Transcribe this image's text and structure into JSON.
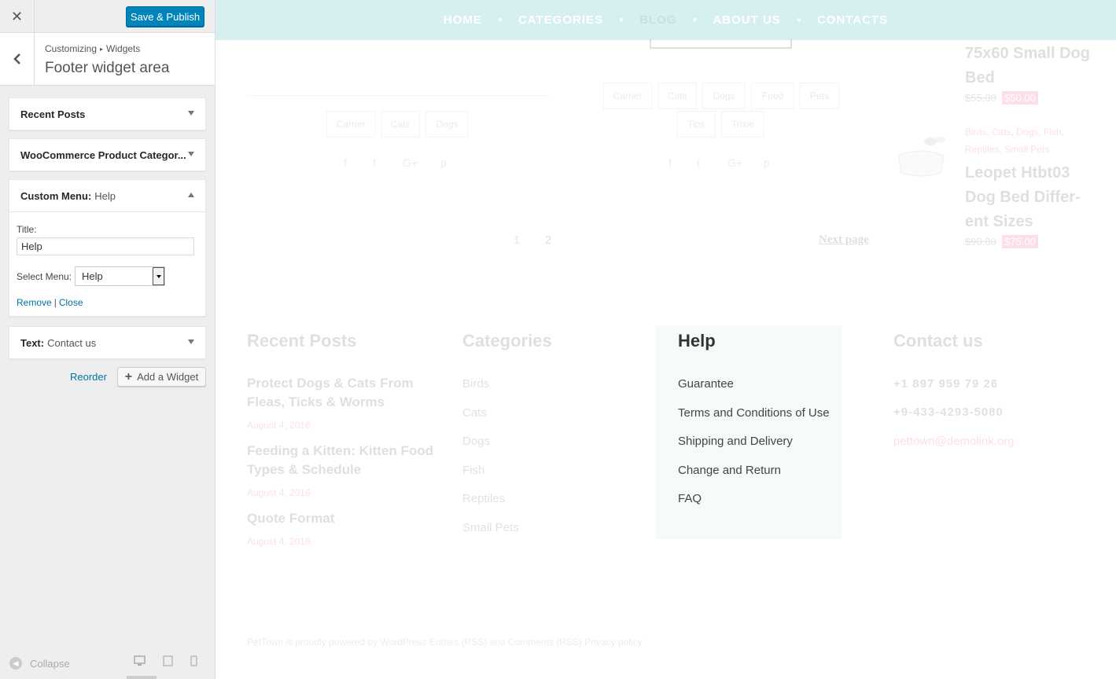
{
  "customizer": {
    "close_glyph": "✕",
    "publish_label": "Save & Publish",
    "breadcrumb": [
      "Customizing",
      "Widgets"
    ],
    "breadcrumb_sep": "▸",
    "section_title": "Footer widget area",
    "widgets": [
      {
        "title": "Recent Posts",
        "subtitle": ""
      },
      {
        "title": "WooCommerce Product Categor...",
        "subtitle": ""
      },
      {
        "title": "Custom Menu:",
        "subtitle": "Help"
      },
      {
        "title": "Text:",
        "subtitle": "Contact us"
      }
    ],
    "form": {
      "title_label": "Title:",
      "title_value": "Help",
      "select_label": "Select Menu:",
      "select_value": "Help",
      "remove_label": "Remove",
      "pipe": "|",
      "close_label": "Close"
    },
    "reorder_label": "Reorder",
    "add_widget_label": "Add a Widget",
    "collapse_label": "Collapse"
  },
  "preview": {
    "nav": [
      "HOME",
      "CATEGORIES",
      "BLOG",
      "ABOUT US",
      "CONTACTS"
    ],
    "left_tags": [
      "Carrier",
      "Cats",
      "Dogs"
    ],
    "mid_tags_row1": [
      "Carrier",
      "Cats",
      "Dogs",
      "Food",
      "Pets"
    ],
    "mid_tags_row2": [
      "Tips",
      "Trixie"
    ],
    "pagination": {
      "page1": "1",
      "page2": "2",
      "next": "Next page"
    },
    "products": [
      {
        "title_lines": [
          "75x60 Small Dog",
          "Bed"
        ],
        "old_price": "$55.00",
        "new_price": "$50.00"
      },
      {
        "cats_line1": "Birds, Cats, Dogs, Fish,",
        "cats_line2": "Reptiles, Small Pets",
        "title_lines": [
          "Leopet Htbt03",
          "Dog Bed Differ-",
          "ent Sizes"
        ],
        "old_price": "$90.00",
        "new_price": "$75.00"
      }
    ],
    "footer": {
      "recent_posts": {
        "title": "Recent Posts",
        "posts": [
          {
            "title_lines": [
              "Protect Dogs & Cats From",
              "Fleas, Ticks & Worms"
            ],
            "date": "August 4, 2016"
          },
          {
            "title_lines": [
              "Feeding a Kitten: Kitten Food",
              "Types & Schedule"
            ],
            "date": "August 4, 2016"
          },
          {
            "title_lines": [
              "Quote Format"
            ],
            "date": "August 4, 2016"
          }
        ]
      },
      "categories": {
        "title": "Categories",
        "items": [
          "Birds",
          "Cats",
          "Dogs",
          "Fish",
          "Reptiles",
          "Small Pets"
        ]
      },
      "help": {
        "title": "Help",
        "items": [
          "Guarantee",
          "Terms and Conditions of Use",
          "Shipping and Delivery",
          "Change and Return",
          "FAQ"
        ]
      },
      "contact": {
        "title": "Contact us",
        "phone1": "+1 897 959 79 26",
        "phone2": "+9-433-4293-5080",
        "email": "pettown@demolink.org"
      },
      "credits": "PetTown is proudly powered by WordPress Entries (RSS) and Comments (RSS) Privacy policy"
    }
  },
  "colors": {
    "accent": "#0085ba",
    "link": "#0073aa",
    "nav_bg": "#d6eff1",
    "sale": "#e8326c"
  }
}
